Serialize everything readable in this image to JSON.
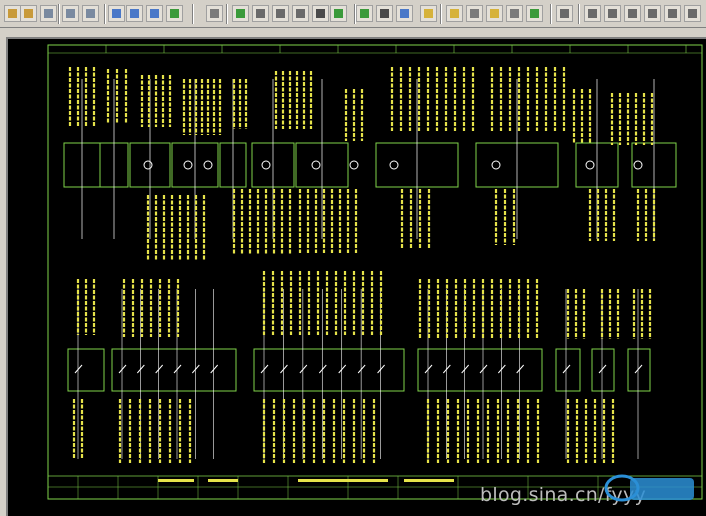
{
  "toolbar": {
    "buttons": [
      {
        "name": "open-icon",
        "color": "#c89a3a"
      },
      {
        "name": "save-icon",
        "color": "#c89a3a"
      },
      {
        "name": "save-all-icon",
        "color": "#7a8aa0"
      },
      {
        "name": "print-icon",
        "color": "#7a8aa0"
      },
      {
        "name": "preview-icon",
        "color": "#7a8aa0"
      },
      {
        "name": "cut-icon",
        "color": "#4a78c8"
      },
      {
        "name": "copy-icon",
        "color": "#4a78c8"
      },
      {
        "name": "paste-icon",
        "color": "#4a78c8"
      },
      {
        "name": "undo-icon",
        "color": "#3a9a3a"
      },
      {
        "name": "pointer-icon",
        "color": "#7a7a7a"
      },
      {
        "name": "line-icon",
        "color": "#3a9a3a"
      },
      {
        "name": "wire-icon",
        "color": "#6a6a6a"
      },
      {
        "name": "component-icon",
        "color": "#6a6a6a"
      },
      {
        "name": "edit-icon",
        "color": "#6a6a6a"
      },
      {
        "name": "block-icon",
        "color": "#4a4a4a"
      },
      {
        "name": "text-icon",
        "color": "#3a9a3a"
      },
      {
        "name": "arc-icon",
        "color": "#3a9a3a"
      },
      {
        "name": "rect-icon",
        "color": "#4a4a4a"
      },
      {
        "name": "frame-icon",
        "color": "#4a78c8"
      },
      {
        "name": "table-icon",
        "color": "#d6b23a"
      },
      {
        "name": "grid-icon",
        "color": "#d6b23a"
      },
      {
        "name": "layer-icon",
        "color": "#7a7a7a"
      },
      {
        "name": "note-icon",
        "color": "#d6b23a"
      },
      {
        "name": "list-icon",
        "color": "#7a7a7a"
      },
      {
        "name": "refresh-icon",
        "color": "#3a9a3a"
      },
      {
        "name": "tool-1-icon",
        "color": "#6a6a6a"
      },
      {
        "name": "tool-2-icon",
        "color": "#6a6a6a"
      },
      {
        "name": "tool-3-icon",
        "color": "#6a6a6a"
      },
      {
        "name": "tool-4-icon",
        "color": "#6a6a6a"
      },
      {
        "name": "tool-5-icon",
        "color": "#6a6a6a"
      },
      {
        "name": "tool-6-icon",
        "color": "#6a6a6a"
      },
      {
        "name": "tool-7-icon",
        "color": "#6a6a6a"
      }
    ]
  },
  "drawing": {
    "background": "#000000",
    "border_color": "#7fd34a",
    "label_color": "#e6e34a",
    "symbol_color": "#ffffff"
  },
  "watermark": "blog.sina.cn/fyyy",
  "logo_colors": [
    "#2b8fd6",
    "#e8e8e8"
  ]
}
